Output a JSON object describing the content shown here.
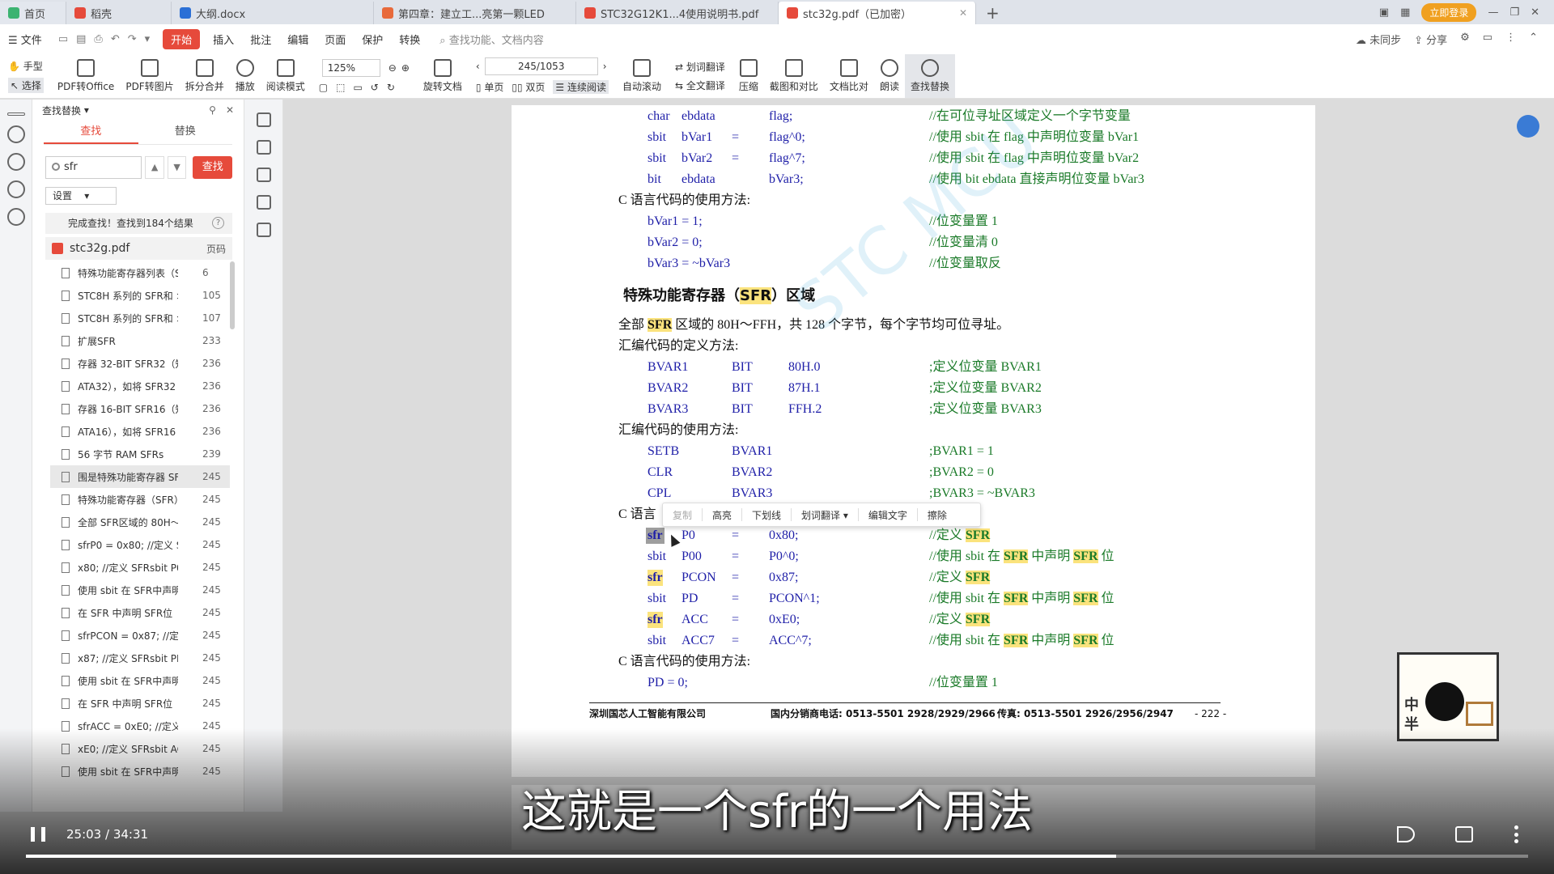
{
  "tabs": [
    {
      "label": "首页",
      "color": "#3cb371"
    },
    {
      "label": "稻壳",
      "color": "#e64a3b"
    },
    {
      "label": "大纲.docx",
      "color": "#2b6fd6"
    },
    {
      "label": "第四章：建立工...亮第一颗LED",
      "color": "#e86a3b"
    },
    {
      "label": "STC32G12K1...4使用说明书.pdf",
      "color": "#e64a3b"
    },
    {
      "label": "stc32g.pdf（已加密）",
      "color": "#e64a3b"
    }
  ],
  "login_label": "立即登录",
  "menu": {
    "file": "文件",
    "items": [
      "开始",
      "插入",
      "批注",
      "编辑",
      "页面",
      "保护",
      "转换"
    ],
    "search_placeholder": "查找功能、文档内容",
    "right": [
      "未同步",
      "分享"
    ]
  },
  "toolbar": {
    "hand": "手型",
    "select": "选择",
    "pdf_to_office": "PDF转Office",
    "pdf_to_image": "PDF转图片",
    "split_merge": "拆分合并",
    "play": "播放",
    "read_mode": "阅读模式",
    "zoom": "125%",
    "page": "245/1053",
    "rotate": "旋转文档",
    "single": "单页",
    "double": "双页",
    "continuous": "连续阅读",
    "auto_scroll": "自动滚动",
    "word_translate": "划词翻译",
    "full_translate": "全文翻译",
    "compress": "压缩",
    "capture_compare": "截图和对比",
    "doc_compare": "文档比对",
    "read_aloud": "朗读",
    "find_replace": "查找替换"
  },
  "panel": {
    "title": "查找替换",
    "tab_find": "查找",
    "tab_replace": "替换",
    "search_value": "sfr",
    "find_button": "查找",
    "settings": "设置",
    "result_info": "完成查找！查找到184个结果",
    "file_name": "stc32g.pdf",
    "page_col": "页码",
    "results": [
      {
        "text": "特殊功能寄存器列表（S",
        "page": "6"
      },
      {
        "text": "STC8H 系列的 SFR和 >",
        "page": "105"
      },
      {
        "text": "STC8H 系列的 SFR和 >",
        "page": "107"
      },
      {
        "text": "扩展SFR",
        "page": "233"
      },
      {
        "text": "存器 32-BIT SFR32（知",
        "page": "236"
      },
      {
        "text": "ATA32），如将 SFR32",
        "page": "236"
      },
      {
        "text": "存器 16-BIT SFR16（知",
        "page": "236"
      },
      {
        "text": "ATA16），如将 SFR16",
        "page": "236"
      },
      {
        "text": "56 字节 RAM SFRs",
        "page": "239"
      },
      {
        "text": "围是特殊功能寄存器 SF",
        "page": "245"
      },
      {
        "text": "特殊功能寄存器（SFR）",
        "page": "245"
      },
      {
        "text": "全部 SFR区域的 80H～",
        "page": "245"
      },
      {
        "text": "sfrP0 = 0x80; //定义 S",
        "page": "245"
      },
      {
        "text": "x80; //定义 SFRsbit P0",
        "page": "245"
      },
      {
        "text": "使用 sbit 在 SFR中声明",
        "page": "245"
      },
      {
        "text": "在 SFR 中声明 SFR位",
        "page": "245"
      },
      {
        "text": "sfrPCON = 0x87; //定",
        "page": "245"
      },
      {
        "text": "x87; //定义 SFRsbit PD",
        "page": "245"
      },
      {
        "text": "使用 sbit 在 SFR中声明",
        "page": "245"
      },
      {
        "text": "在 SFR 中声明 SFR位",
        "page": "245"
      },
      {
        "text": "sfrACC = 0xE0; //定义",
        "page": "245"
      },
      {
        "text": "xE0; //定义 SFRsbit AC",
        "page": "245"
      },
      {
        "text": "使用 sbit 在 SFR中声明",
        "page": "245"
      }
    ]
  },
  "doc": {
    "watermark": "STC MCU",
    "r1": {
      "a": "char",
      "b": "ebdata",
      "c": "flag;",
      "comment": "//在可位寻址区域定义一个字节变量"
    },
    "r2": {
      "a": "sbit",
      "b": "bVar1",
      "eq": "=",
      "c": "flag^0;",
      "comment": "//使用 sbit 在 flag 中声明位变量 bVar1"
    },
    "r3": {
      "a": "sbit",
      "b": "bVar2",
      "eq": "=",
      "c": "flag^7;",
      "comment": "//使用 sbit 在 flag 中声明位变量 bVar2"
    },
    "r4": {
      "a": "bit",
      "b": "ebdata",
      "c": "bVar3;",
      "comment": "//使用 bit ebdata 直接声明位变量 bVar3"
    },
    "c_usage": "C 语言代码的使用方法:",
    "u1": {
      "code": "bVar1 = 1;",
      "comment": "//位变量置 1"
    },
    "u2": {
      "code": "bVar2 = 0;",
      "comment": "//位变量清 0"
    },
    "u3": {
      "code": "bVar3 = ~bVar3",
      "comment": "//位变量取反"
    },
    "heading_pre": "特殊功能寄存器（",
    "heading_hl": "SFR",
    "heading_post": "）区域",
    "para_pre": "全部 ",
    "para_hl": "SFR",
    "para_post": " 区域的 80H～FFH，共 128 个字节，每个字节均可位寻址。",
    "asm_def": "汇编代码的定义方法:",
    "a1": {
      "a": "BVAR1",
      "b": "BIT",
      "c": "80H.0",
      "comment": ";定义位变量 BVAR1"
    },
    "a2": {
      "a": "BVAR2",
      "b": "BIT",
      "c": "87H.1",
      "comment": ";定义位变量 BVAR2"
    },
    "a3": {
      "a": "BVAR3",
      "b": "BIT",
      "c": "FFH.2",
      "comment": ";定义位变量 BVAR3"
    },
    "asm_usage": "汇编代码的使用方法:",
    "s1": {
      "a": "SETB",
      "b": "BVAR1",
      "comment": ";BVAR1 = 1"
    },
    "s2": {
      "a": "CLR",
      "b": "BVAR2",
      "comment": ";BVAR2 = 0"
    },
    "s3": {
      "a": "CPL",
      "b": "BVAR3",
      "comment": ";BVAR3 = ~BVAR3"
    },
    "c_def_partial": "C 语言",
    "k1": {
      "a": "sfr",
      "b": "P0",
      "eq": "=",
      "c": "0x80;",
      "cm_pre": "//定义 ",
      "cm_hl": "SFR"
    },
    "k2": {
      "a": "sbit",
      "b": "P00",
      "eq": "=",
      "c": "P0^0;",
      "cm1": "//使用 sbit 在 ",
      "hl1": "SFR",
      "cm2": " 中声明 ",
      "hl2": "SFR",
      "cm3": " 位"
    },
    "k3": {
      "a": "sfr",
      "b": "PCON",
      "eq": "=",
      "c": "0x87;",
      "cm_pre": "//定义 ",
      "cm_hl": "SFR"
    },
    "k4": {
      "a": "sbit",
      "b": "PD",
      "eq": "=",
      "c": "PCON^1;",
      "cm1": "//使用 sbit 在 ",
      "hl1": "SFR",
      "cm2": " 中声明 ",
      "hl2": "SFR",
      "cm3": " 位"
    },
    "k5": {
      "a": "sfr",
      "b": "ACC",
      "eq": "=",
      "c": "0xE0;",
      "cm_pre": "//定义 ",
      "cm_hl": "SFR"
    },
    "k6": {
      "a": "sbit",
      "b": "ACC7",
      "eq": "=",
      "c": "ACC^7;",
      "cm1": "//使用 sbit 在 ",
      "hl1": "SFR",
      "cm2": " 中声明 ",
      "hl2": "SFR",
      "cm3": " 位"
    },
    "c_usage2": "C 语言代码的使用方法:",
    "p1": {
      "code": "PD = 0;",
      "comment": "//位变量置 1"
    },
    "footer_company": "深圳国芯人工智能有限公司",
    "footer_phone": "国内分销商电话: 0513-5501 2928/2929/2966",
    "footer_fax": "传真: 0513-5501 2926/2956/2947",
    "footer_page": "- 222 -"
  },
  "context_menu": [
    "复制",
    "高亮",
    "下划线",
    "划词翻译",
    "编辑文字",
    "擦除"
  ],
  "mascot": {
    "ch1": "中",
    "ch2": "半"
  },
  "video": {
    "subtitle": "这就是一个sfr的一个用法",
    "time": "25:03 / 34:31",
    "progress": 0.726
  }
}
